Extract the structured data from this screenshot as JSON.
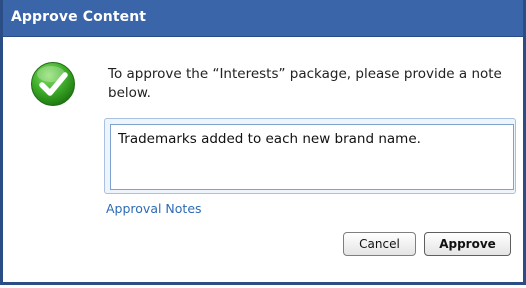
{
  "dialog": {
    "title": "Approve Content",
    "message": "To approve the “Interests” package, please provide a note below.",
    "note_value": "Trademarks added to each new brand name.",
    "notes_label": "Approval Notes",
    "icon": "check-circle-icon",
    "buttons": {
      "cancel": "Cancel",
      "approve": "Approve"
    }
  },
  "colors": {
    "titlebar": "#3a65a8",
    "link": "#2c6bb7",
    "success": "#3fae2a"
  }
}
